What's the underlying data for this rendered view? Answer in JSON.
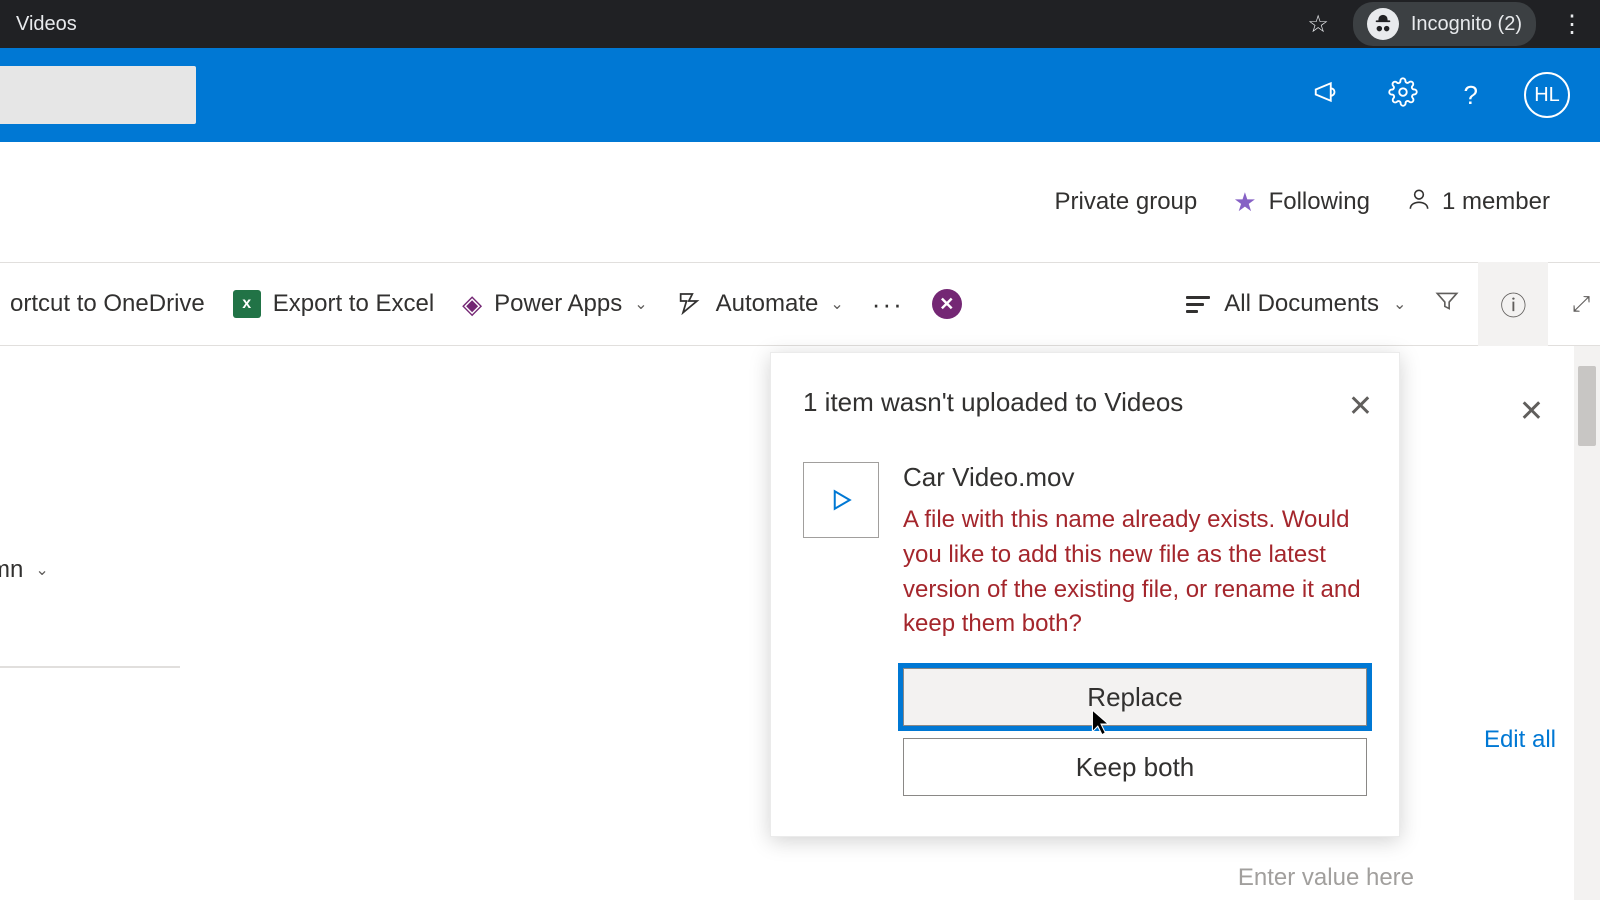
{
  "browser": {
    "tab_title": "Videos",
    "incognito_label": "Incognito (2)"
  },
  "header": {
    "avatar_initials": "HL"
  },
  "group_info": {
    "privacy": "Private group",
    "following_label": "Following",
    "members_label": "1 member"
  },
  "commands": {
    "shortcut": "ortcut to OneDrive",
    "export_excel": "Export to Excel",
    "power_apps": "Power Apps",
    "automate": "Automate",
    "view_label": "All Documents"
  },
  "column_header": "mn",
  "side_panel": {
    "edit_all": "Edit all",
    "enter_placeholder": "Enter value here"
  },
  "dialog": {
    "title": "1 item wasn't uploaded to Videos",
    "file_name": "Car Video.mov",
    "message": "A file with this name already exists. Would you like to add this new file as the latest version of the existing file, or rename it and keep them both?",
    "replace_label": "Replace",
    "keep_both_label": "Keep both"
  }
}
